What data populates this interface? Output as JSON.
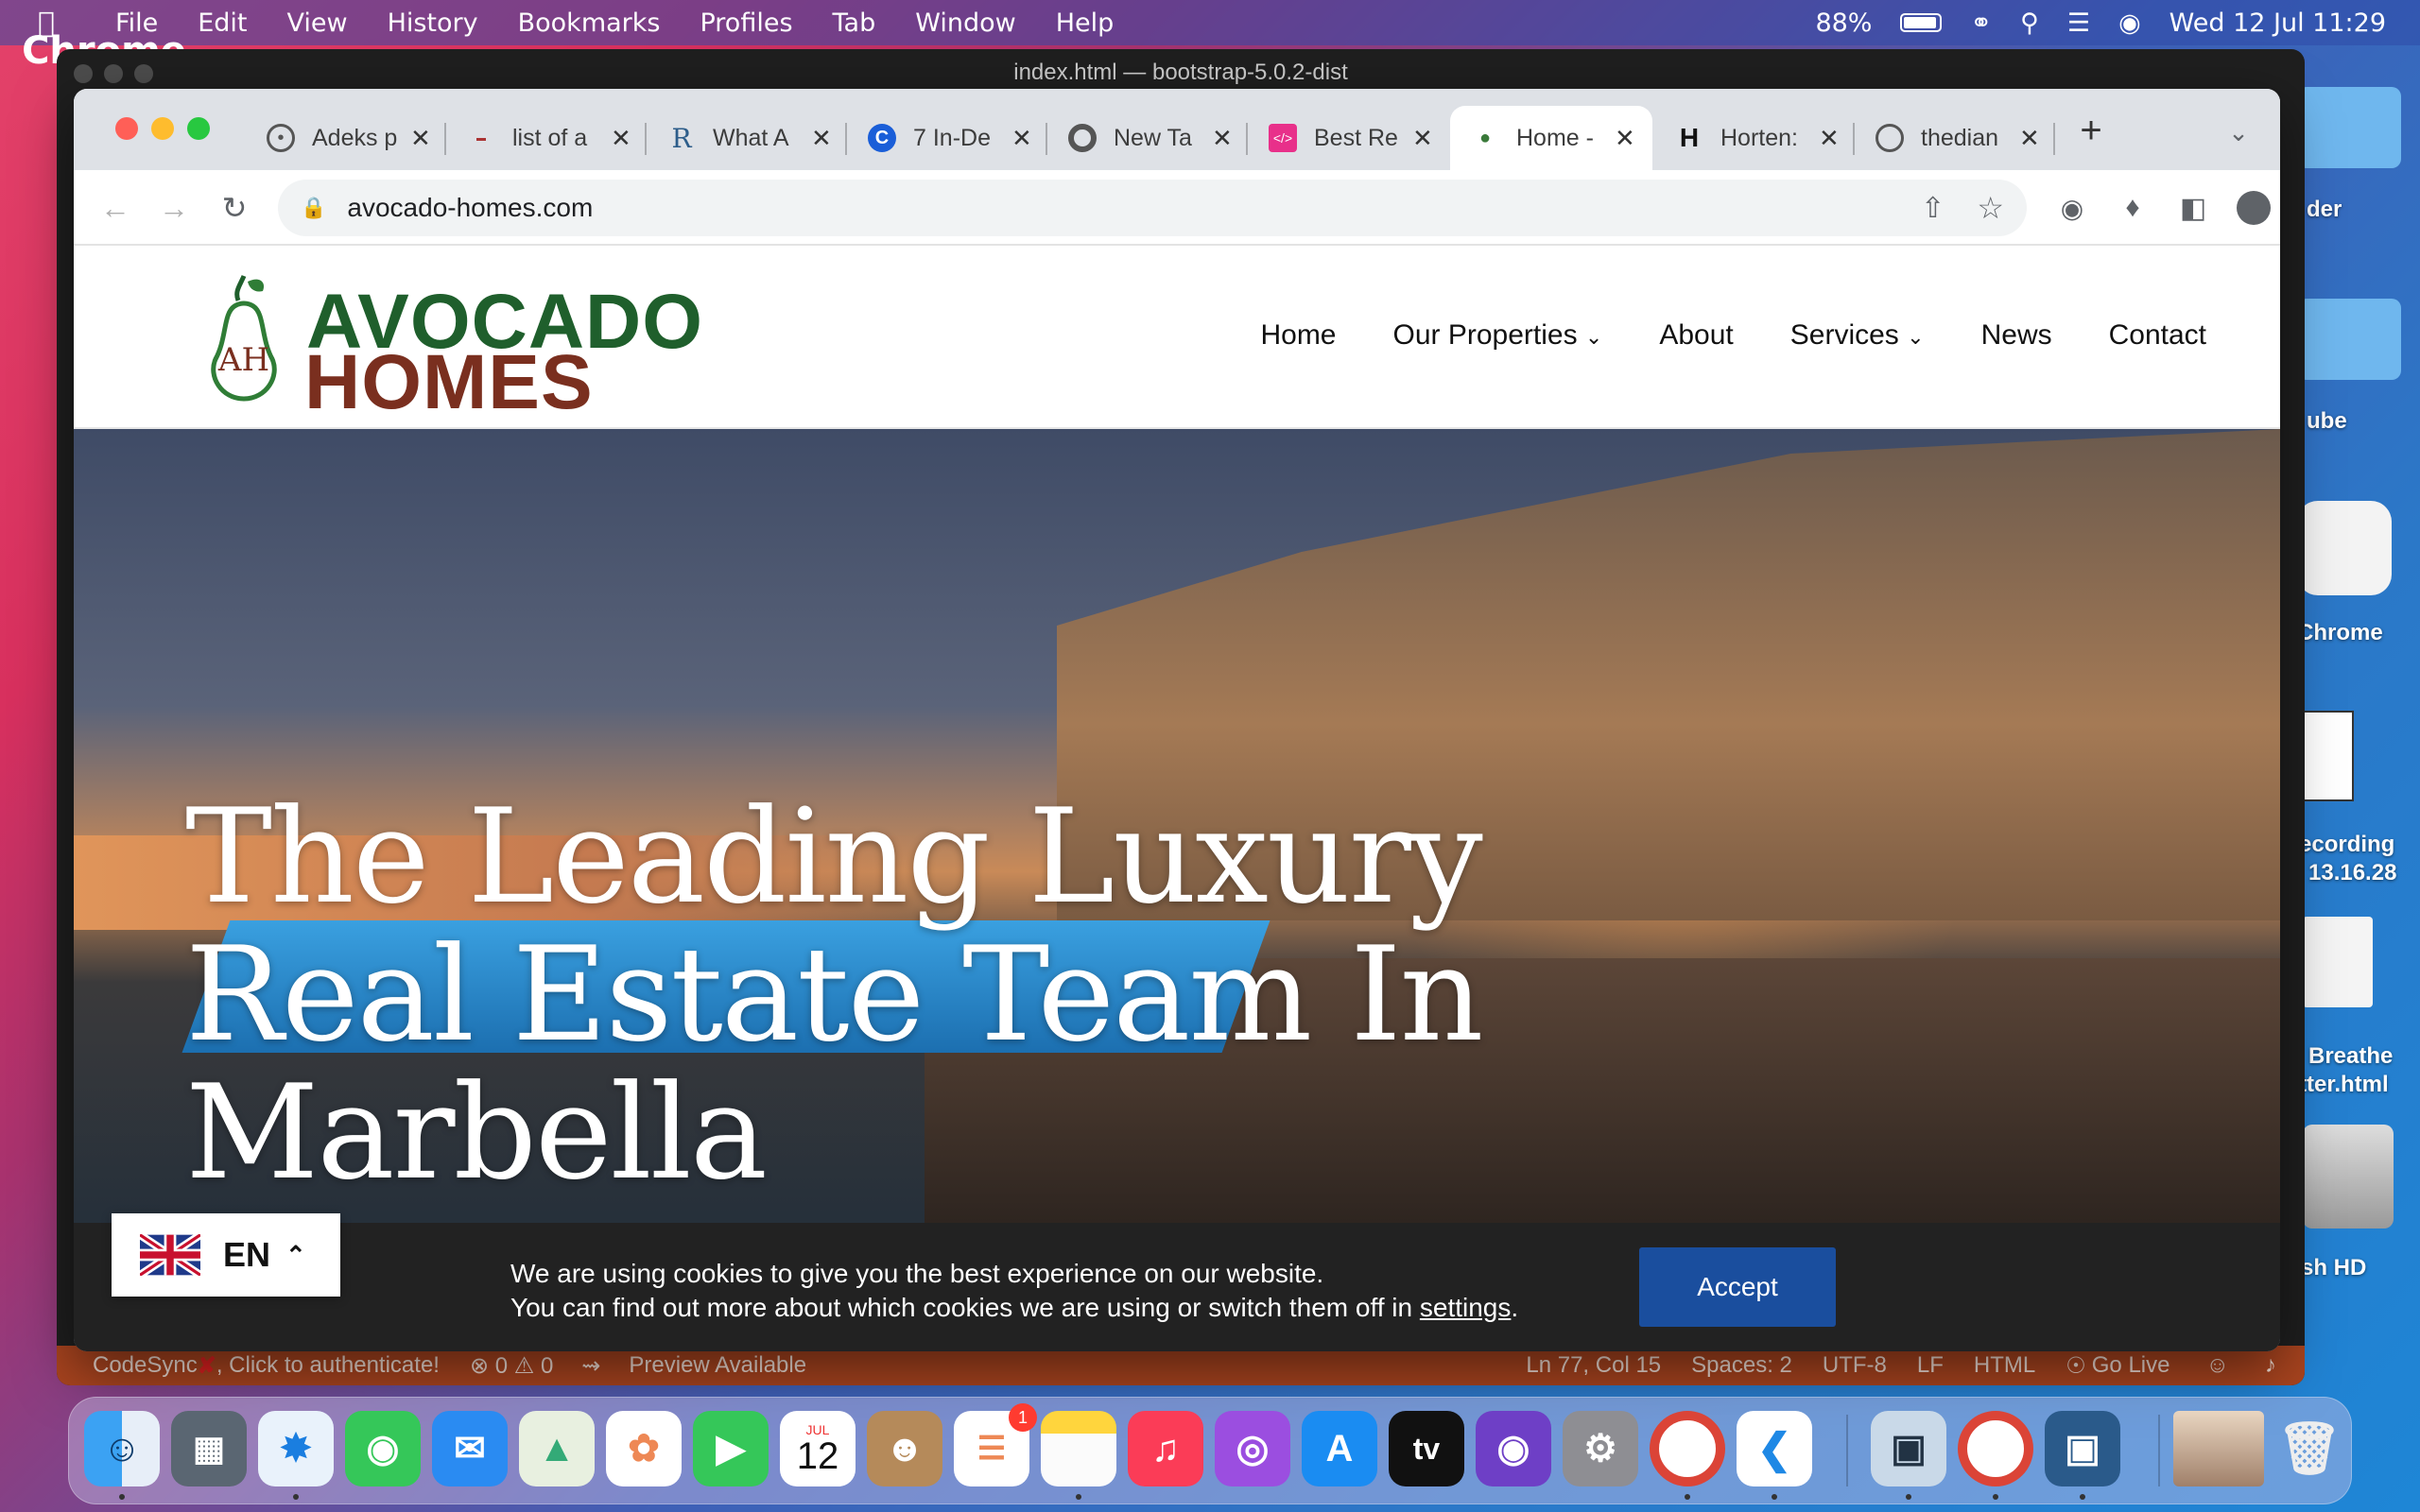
{
  "menubar": {
    "app": "Chrome",
    "items": [
      "File",
      "Edit",
      "View",
      "History",
      "Bookmarks",
      "Profiles",
      "Tab",
      "Window",
      "Help"
    ],
    "battery": "88%",
    "datetime": "Wed 12 Jul  11:29"
  },
  "desktop": {
    "items": [
      "der",
      "ube",
      "Chrome",
      "ecording",
      "13.16.28",
      "Breathe",
      "tter.html",
      "sh HD"
    ]
  },
  "vscode": {
    "title": "index.html — bootstrap-5.0.2-dist",
    "status": {
      "codesync": "CodeSync",
      "auth": ", Click to authenticate!",
      "errors": "⊗ 0 ⚠ 0",
      "preview": "Preview Available",
      "position": "Ln 77, Col 15",
      "spaces": "Spaces: 2",
      "encoding": "UTF-8",
      "eol": "LF",
      "language": "HTML",
      "golive": "Go Live"
    }
  },
  "browser": {
    "tabs": [
      {
        "title": "Adeks p",
        "icon": "globe-icon"
      },
      {
        "title": "list of a",
        "icon": "site-icon"
      },
      {
        "title": "What A",
        "icon": "r-icon"
      },
      {
        "title": "7 In-De",
        "icon": "c-icon"
      },
      {
        "title": "New Ta",
        "icon": "chrome-icon"
      },
      {
        "title": "Best Re",
        "icon": "code-icon"
      },
      {
        "title": "Home -",
        "icon": "avocado-icon"
      },
      {
        "title": "Horten:",
        "icon": "h-icon"
      },
      {
        "title": "thedian",
        "icon": "globe-icon"
      }
    ],
    "url": "avocado-homes.com"
  },
  "site": {
    "logo_top": "AVOCADO",
    "logo_bottom": "HOMES",
    "nav": [
      "Home",
      "Our Properties",
      "About",
      "Services",
      "News",
      "Contact"
    ],
    "hero_line1": "The Leading Luxury",
    "hero_line2": "Real Estate Team In",
    "hero_line3": "Marbella",
    "cookie_line1": "We are using cookies to give you the best experience on our website.",
    "cookie_line2_pre": "You can find out more about which cookies we are using or switch them off in ",
    "cookie_link": "settings",
    "cookie_line2_post": ".",
    "accept": "Accept",
    "lang": "EN"
  },
  "dock": {
    "calendar_month": "JUL",
    "calendar_day": "12",
    "reminders_badge": "1",
    "tv_label": "tv"
  },
  "colors": {
    "logo_green": "#1f5f2c",
    "logo_brown": "#7a2f1f",
    "accept_blue": "#1a4e9e",
    "status_orange": "#a9441f"
  }
}
